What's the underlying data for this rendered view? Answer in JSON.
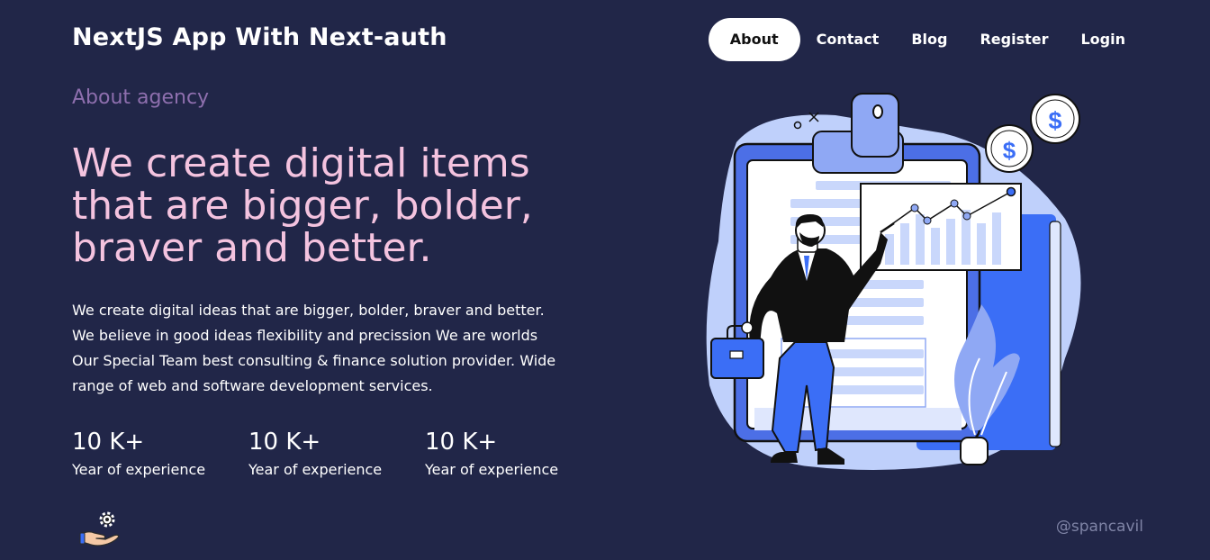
{
  "header": {
    "brand": "NextJS App With Next-auth",
    "nav": [
      {
        "label": "About",
        "active": true
      },
      {
        "label": "Contact",
        "active": false
      },
      {
        "label": "Blog",
        "active": false
      },
      {
        "label": "Register",
        "active": false
      },
      {
        "label": "Login",
        "active": false
      }
    ]
  },
  "hero": {
    "eyebrow": "About agency",
    "headline_lines": [
      "We create digital items",
      "that are bigger, bolder,",
      "braver and better."
    ],
    "description_lines": [
      "We create digital ideas that are bigger, bolder, braver and better.",
      "We believe in good ideas flexibility and precission We are worlds",
      "Our Special Team best consulting & finance solution provider. Wide",
      "range of web and software development services."
    ],
    "stats": [
      {
        "value": "10 K+",
        "label": "Year of experience"
      },
      {
        "value": "10 K+",
        "label": "Year of experience"
      },
      {
        "value": "10 K+",
        "label": "Year of experience"
      }
    ],
    "illustration_dollar_symbol": "$"
  },
  "footer": {
    "handle": "@spancavil",
    "icons": [
      "hand-gear-icon"
    ]
  },
  "colors": {
    "background": "#212648",
    "headline": "#f4c3df",
    "eyebrow": "#8e6fae",
    "accent_blue": "#3b6ef6",
    "light_blue": "#bfd0fb"
  }
}
